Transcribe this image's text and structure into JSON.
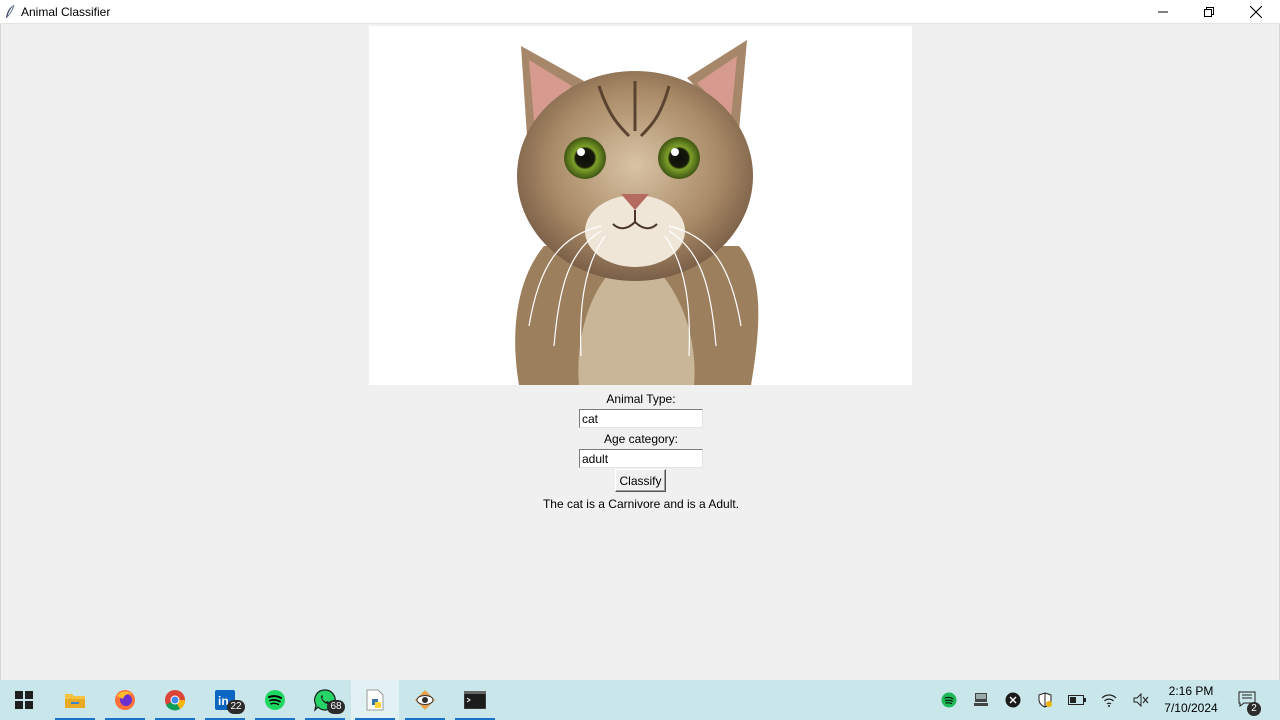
{
  "window": {
    "title": "Animal Classifier",
    "minimize_icon": "minimize-icon",
    "maximize_icon": "restore-icon",
    "close_icon": "close-icon"
  },
  "image": {
    "subject_icon": "cat-photo"
  },
  "form": {
    "animal_type_label": "Animal Type:",
    "animal_type_value": "cat",
    "age_category_label": "Age category:",
    "age_category_value": "adult",
    "classify_label": "Classify",
    "result_text": "The cat is a Carnivore and is a Adult."
  },
  "taskbar": {
    "items": [
      {
        "name": "start",
        "icon": "windows-icon",
        "badge": ""
      },
      {
        "name": "file-explorer",
        "icon": "folder-icon",
        "badge": ""
      },
      {
        "name": "firefox",
        "icon": "firefox-icon",
        "badge": ""
      },
      {
        "name": "chrome",
        "icon": "chrome-icon",
        "badge": ""
      },
      {
        "name": "linkedin",
        "icon": "linkedin-icon",
        "badge": "22"
      },
      {
        "name": "spotify",
        "icon": "spotify-icon",
        "badge": ""
      },
      {
        "name": "whatsapp",
        "icon": "whatsapp-icon",
        "badge": "68"
      },
      {
        "name": "python-app",
        "icon": "python-file-icon",
        "badge": ""
      },
      {
        "name": "app-eye",
        "icon": "eye-app-icon",
        "badge": ""
      },
      {
        "name": "terminal",
        "icon": "terminal-icon",
        "badge": ""
      }
    ],
    "clock_time": "2:16 PM",
    "clock_date": "7/10/2024",
    "notification_count": "2",
    "accent": "#1a73c8",
    "background": "#c9e6ea"
  }
}
